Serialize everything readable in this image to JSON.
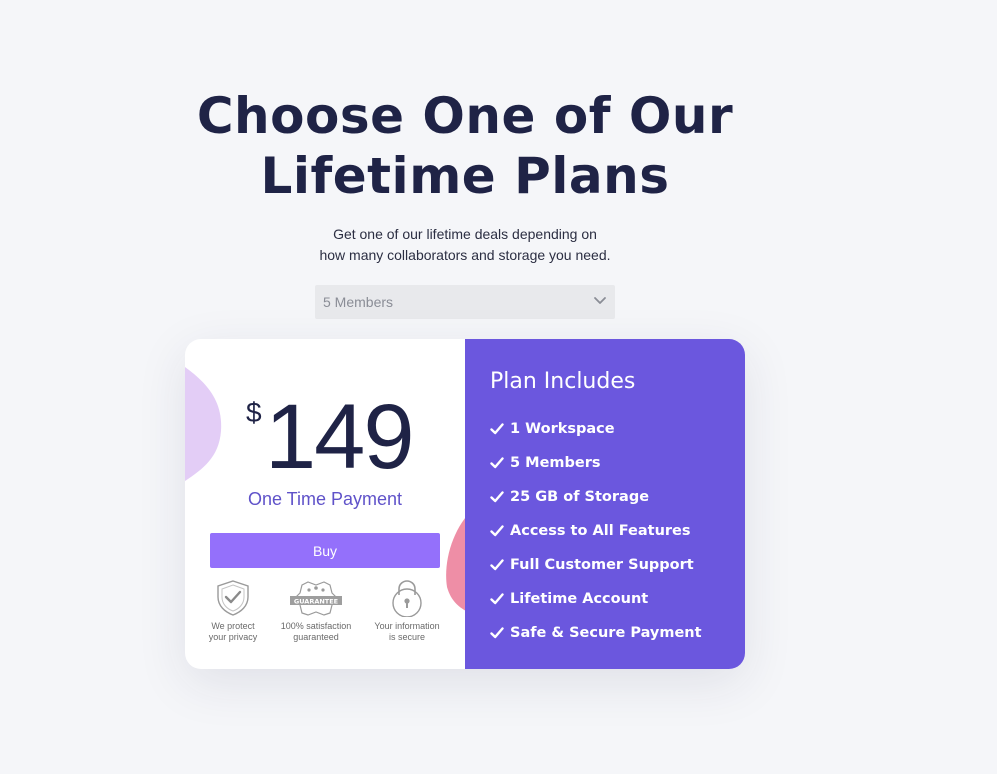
{
  "hero": {
    "title_line1": "Choose One of Our",
    "title_line2": "Lifetime Plans",
    "subtitle_line1": "Get one of our lifetime deals depending on",
    "subtitle_line2": "how many collaborators and storage you need."
  },
  "members_select": {
    "value": "5 Members",
    "icon": "chevron-down-icon"
  },
  "pricing": {
    "currency": "$",
    "amount": "149",
    "payment_label": "One Time Payment",
    "buy_label": "Buy",
    "badges": [
      {
        "icon": "shield-check-icon",
        "line1": "We protect",
        "line2": "your privacy"
      },
      {
        "icon": "guarantee-seal-icon",
        "seal_text": "GUARANTEE",
        "line1": "100% satisfaction",
        "line2": "guaranteed"
      },
      {
        "icon": "padlock-icon",
        "line1": "Your information",
        "line2": "is secure"
      }
    ]
  },
  "plan_includes": {
    "title": "Plan Includes",
    "items": [
      "1 Workspace",
      "5 Members",
      "25 GB of Storage",
      "Access to All Features",
      "Full Customer Support",
      "Lifetime Account",
      "Safe & Secure Payment"
    ]
  },
  "colors": {
    "background": "#f5f6f9",
    "heading": "#1f2346",
    "accent_purple": "#6b57de",
    "buy_button": "#9470fb",
    "lavender_blob": "#e3cdf6",
    "pink_blob": "#ee8ea6"
  }
}
